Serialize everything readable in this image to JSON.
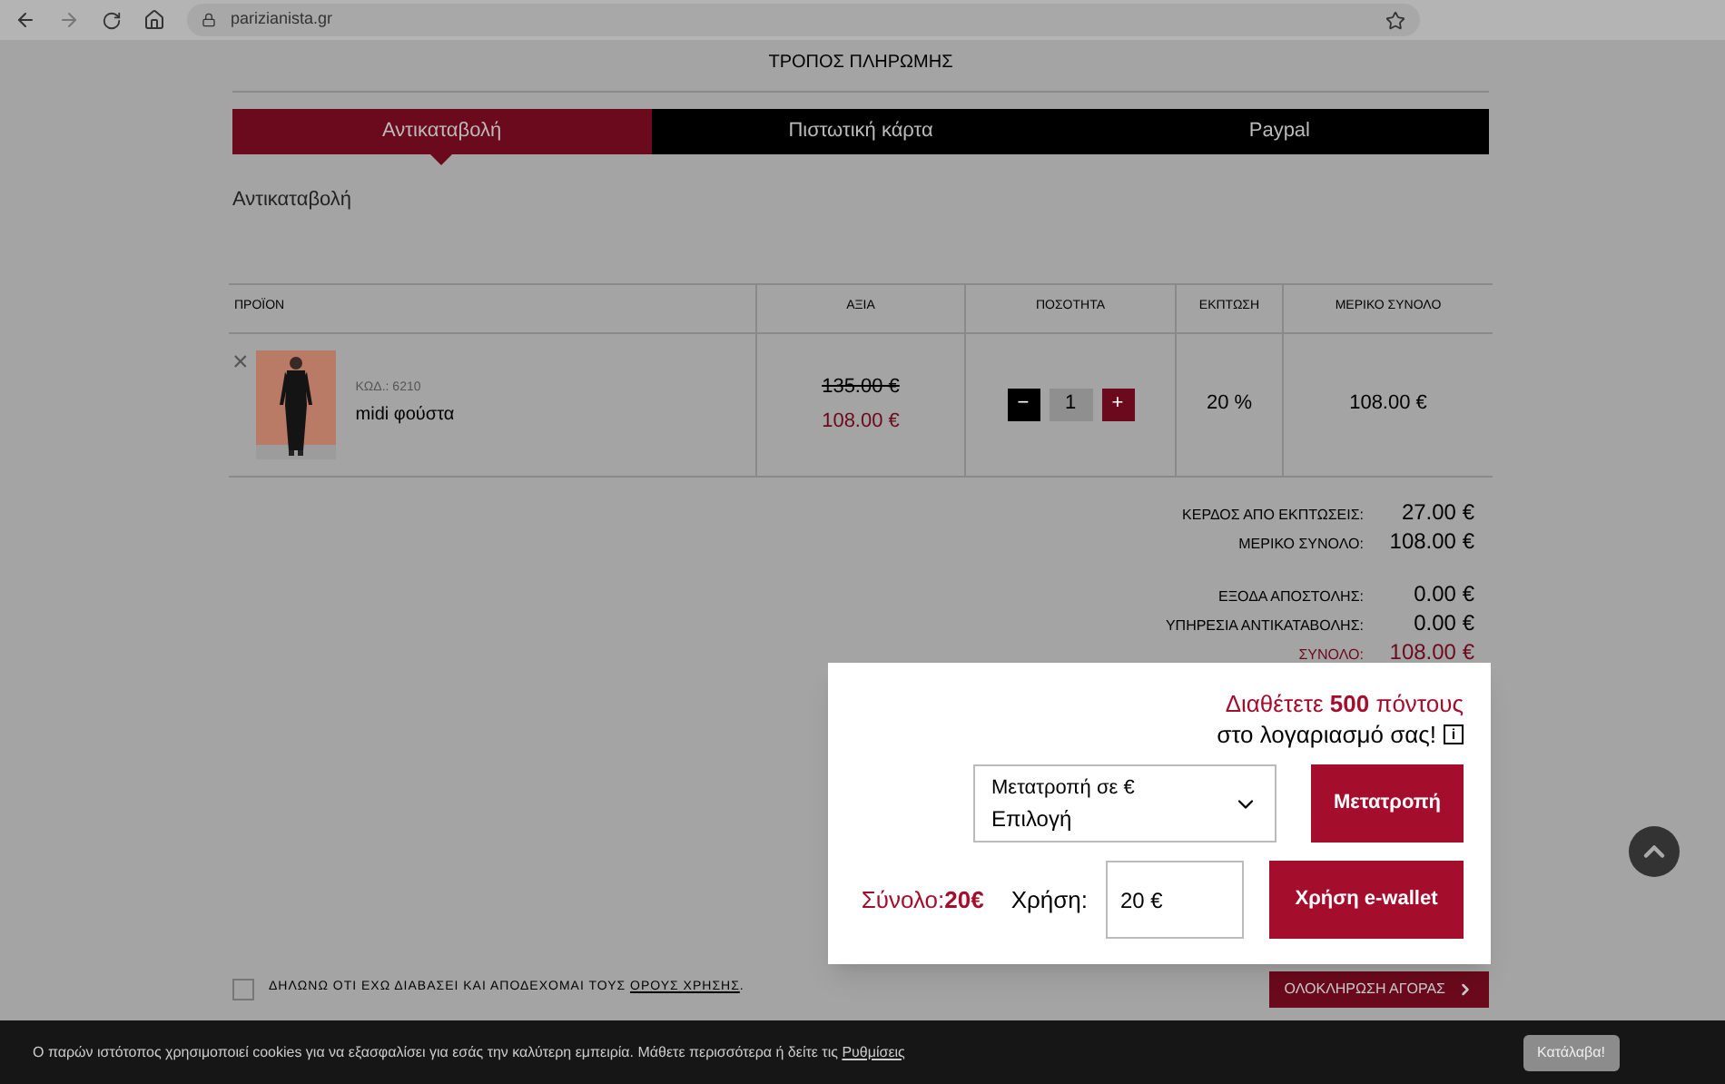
{
  "browser": {
    "url": "parizianista.gr"
  },
  "payment": {
    "title": "ΤΡΟΠΟΣ ΠΛΗΡΩΜΗΣ",
    "tabs": [
      {
        "label": "Αντικαταβολή",
        "selected": true
      },
      {
        "label": "Πιστωτική κάρτα",
        "selected": false
      },
      {
        "label": "Paypal",
        "selected": false
      }
    ],
    "method_text": "Αντικαταβολή"
  },
  "cart": {
    "columns": [
      "ΠΡΟΪΟΝ",
      "ΑΞΙΑ",
      "ΠΟΣΟΤΗΤΑ",
      "ΕΚΠΤΩΣΗ",
      "ΜΕΡΙΚΟ ΣΥΝΟΛΟ"
    ],
    "rows": [
      {
        "remove": "×",
        "code": "ΚΩΔ.: 6210",
        "name": "midi φούστα",
        "old_price": "135.00 €",
        "price": "108.00 €",
        "minus": "−",
        "quantity": "1",
        "plus": "+",
        "discount": "20 %",
        "subtotal": "108.00 €"
      }
    ]
  },
  "totals": {
    "summary": [
      {
        "label": "ΚΕΡΔΟΣ ΑΠΟ ΕΚΠΤΩΣΕΙΣ:",
        "value": "27.00 €",
        "kind": "plain"
      },
      {
        "label": "ΜΕΡΙΚΟ ΣΥΝΟΛΟ:",
        "value": "108.00 €",
        "kind": "plain"
      }
    ],
    "charges": [
      {
        "label": "ΕΞΟΔΑ ΑΠΟΣΤΟΛΗΣ:",
        "value": "0.00 €",
        "kind": "plain"
      },
      {
        "label": "ΥΠΗΡΕΣΙΑ ΑΝΤΙΚΑΤΑΒΟΛΗΣ:",
        "value": "0.00 €",
        "kind": "plain"
      },
      {
        "label": "ΣΥΝΟΛΟ:",
        "value": "108.00 €",
        "kind": "grand"
      }
    ]
  },
  "terms": {
    "text": "ΔΗΛΩΝΩ ΟΤΙ ΕΧΩ ΔΙΑΒΑΣΕΙ ΚΑΙ ΑΠΟΔΕΧΟΜΑΙ ΤΟΥΣ",
    "link": "ΟΡΟΥΣ ΧΡΗΣΗΣ",
    "after": ".",
    "checked": false
  },
  "checkout_button": "ΟΛΟΚΛΗΡΩΣΗ ΑΓΟΡΑΣ",
  "wallet": {
    "points_line": "Διαθέτετε **500** πόντους",
    "account_line": "στο λογαριασμό σας!",
    "info": "i",
    "select": {
      "label": "Μετατροπή σε €",
      "value": "Επιλογή"
    },
    "convert_button": "Μετατροπή",
    "total": "Σύνολο:**20€**",
    "use_label": "Χρήση:",
    "use_value": "20 €",
    "use_button": "Χρήση e-wallet"
  },
  "cookie": {
    "text": "Ο παρών ιστότοπος χρησιμοποιεί cookies για να εξασφαλίσει για εσάς την καλύτερη εμπειρία. Μάθετε περισσότερα ή δείτε τις",
    "link": "Ρυθμίσεις",
    "button": "Κατάλαβα!"
  }
}
